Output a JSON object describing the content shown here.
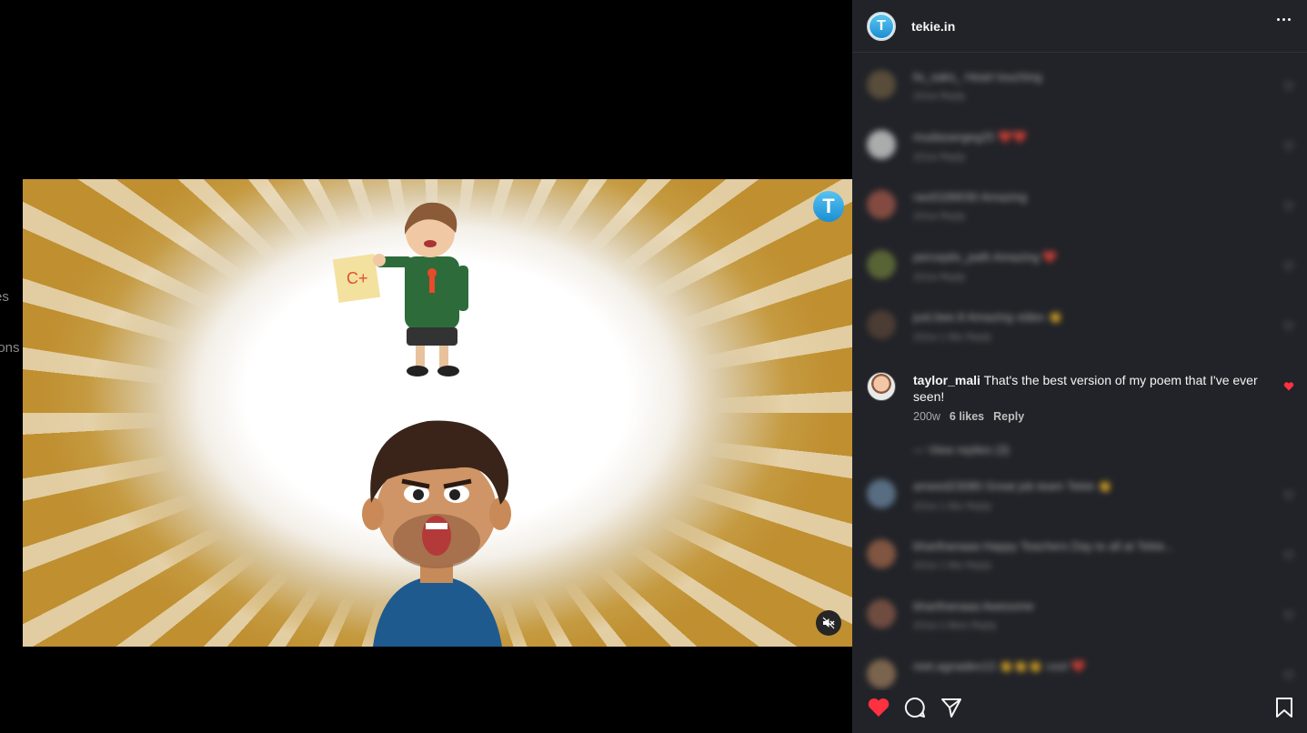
{
  "background": {
    "ghost_texts": [
      "es",
      "ions"
    ]
  },
  "video": {
    "logo_letter": "T",
    "mute_icon": "speaker-muted-icon"
  },
  "header": {
    "username": "tekie.in",
    "avatar_letter": "T",
    "more_icon": "more-horizontal-icon"
  },
  "comments": [
    {
      "blurred": true,
      "text": "lis_saks_ Heart touching",
      "meta": "201w  Reply"
    },
    {
      "blurred": true,
      "text": "mudasangeg25 ❤️❤️",
      "meta": "201w  Reply"
    },
    {
      "blurred": true,
      "text": "ravi0189030 Amazing",
      "meta": "201w  Reply"
    },
    {
      "blurred": true,
      "text": "perceptiv_path Amazing ❤️",
      "meta": "201w  Reply"
    },
    {
      "blurred": true,
      "text": "just.bee.8 Amazing video 👏",
      "meta": "201w  1 like  Reply"
    },
    {
      "blurred": false,
      "username": "taylor_mali",
      "text": "That's the best version of my poem that I've ever seen!",
      "time": "200w",
      "likes": "6 likes",
      "reply": "Reply",
      "liked": true
    },
    {
      "blurred": true,
      "text": "—  View replies (3)",
      "meta": ""
    },
    {
      "blurred": true,
      "text": "ameed23080 Great job team Tekie 👏",
      "meta": "201w  1 like  Reply"
    },
    {
      "blurred": true,
      "text": "bharthanaaa Happy Teachers Day to all at Tekie...",
      "meta": "201w  1 like  Reply"
    },
    {
      "blurred": true,
      "text": "bharthanaaa Awesome",
      "meta": "201w  2 likes  Reply"
    },
    {
      "blurred": true,
      "text": "reet.agnadev13 👏👏👏 cool ❤️",
      "meta": ""
    }
  ],
  "actions": {
    "like_icon": "heart-filled-icon",
    "comment_icon": "comment-icon",
    "share_icon": "paper-plane-icon",
    "save_icon": "bookmark-icon"
  },
  "colors": {
    "panel_bg": "#212328",
    "like_red": "#ff3040",
    "accent_blue": "#1c8ed2"
  }
}
